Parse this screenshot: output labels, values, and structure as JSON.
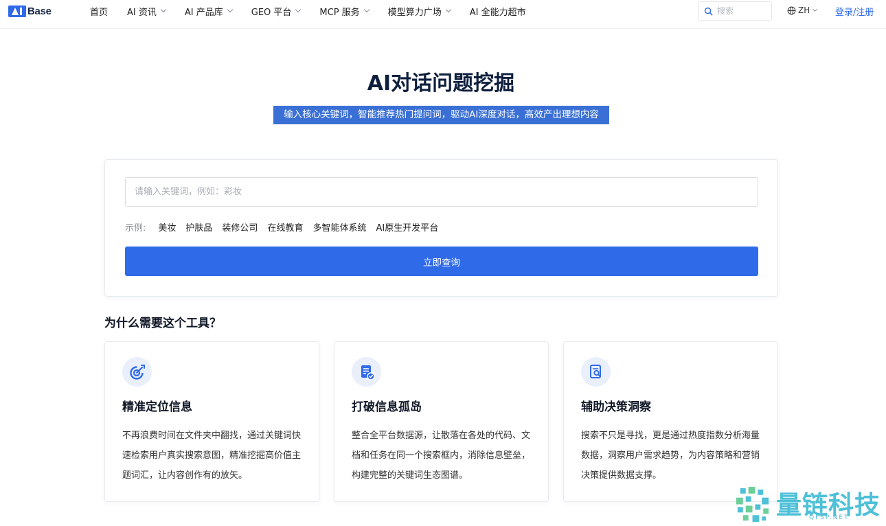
{
  "brand": {
    "logo_text": "Base"
  },
  "nav": {
    "items": [
      {
        "label": "首页",
        "has_dropdown": false
      },
      {
        "label": "AI 资讯",
        "has_dropdown": true
      },
      {
        "label": "AI 产品库",
        "has_dropdown": true
      },
      {
        "label": "GEO 平台",
        "has_dropdown": true
      },
      {
        "label": "MCP 服务",
        "has_dropdown": true
      },
      {
        "label": "模型算力广场",
        "has_dropdown": true
      },
      {
        "label": "AI 全能力超市",
        "has_dropdown": false
      }
    ],
    "search_placeholder": "搜索",
    "language": "ZH",
    "login_label": "登录/注册"
  },
  "hero": {
    "title": "AI对话问题挖掘",
    "subtitle": "输入核心关键词，智能推荐热门提问词，驱动AI深度对话，高效产出理想内容"
  },
  "search_card": {
    "input_placeholder": "请输入关键词，例如：彩妆",
    "examples_label": "示例:",
    "examples": [
      "美妆",
      "护肤品",
      "装修公司",
      "在线教育",
      "多智能体系统",
      "AI原生开发平台"
    ],
    "submit_label": "立即查询"
  },
  "why_section": {
    "heading": "为什么需要这个工具？",
    "features": [
      {
        "icon": "target-icon",
        "title": "精准定位信息",
        "description": "不再浪费时间在文件夹中翻找，通过关键词快速检索用户真实搜索意图，精准挖掘高价值主题词汇，让内容创作有的放矢。"
      },
      {
        "icon": "document-check-icon",
        "title": "打破信息孤岛",
        "description": "整合全平台数据源，让散落在各处的代码、文档和任务在同一个搜索框内，消除信息壁垒，构建完整的关键词生态图谱。"
      },
      {
        "icon": "report-search-icon",
        "title": "辅助决策洞察",
        "description": "搜索不只是寻找，更是通过热度指数分析海量数据，洞察用户需求趋势，为内容策略和营销决策提供数据支撑。"
      }
    ]
  },
  "watermark": {
    "text": "量链科技",
    "subtext": "QFSP.NET"
  },
  "colors": {
    "accent": "#2f6be8",
    "subtitle_highlight": "#3a70d6",
    "title": "#0f1f3d",
    "icon_bg": "#e9effb",
    "watermark": "#4ec0d8"
  }
}
